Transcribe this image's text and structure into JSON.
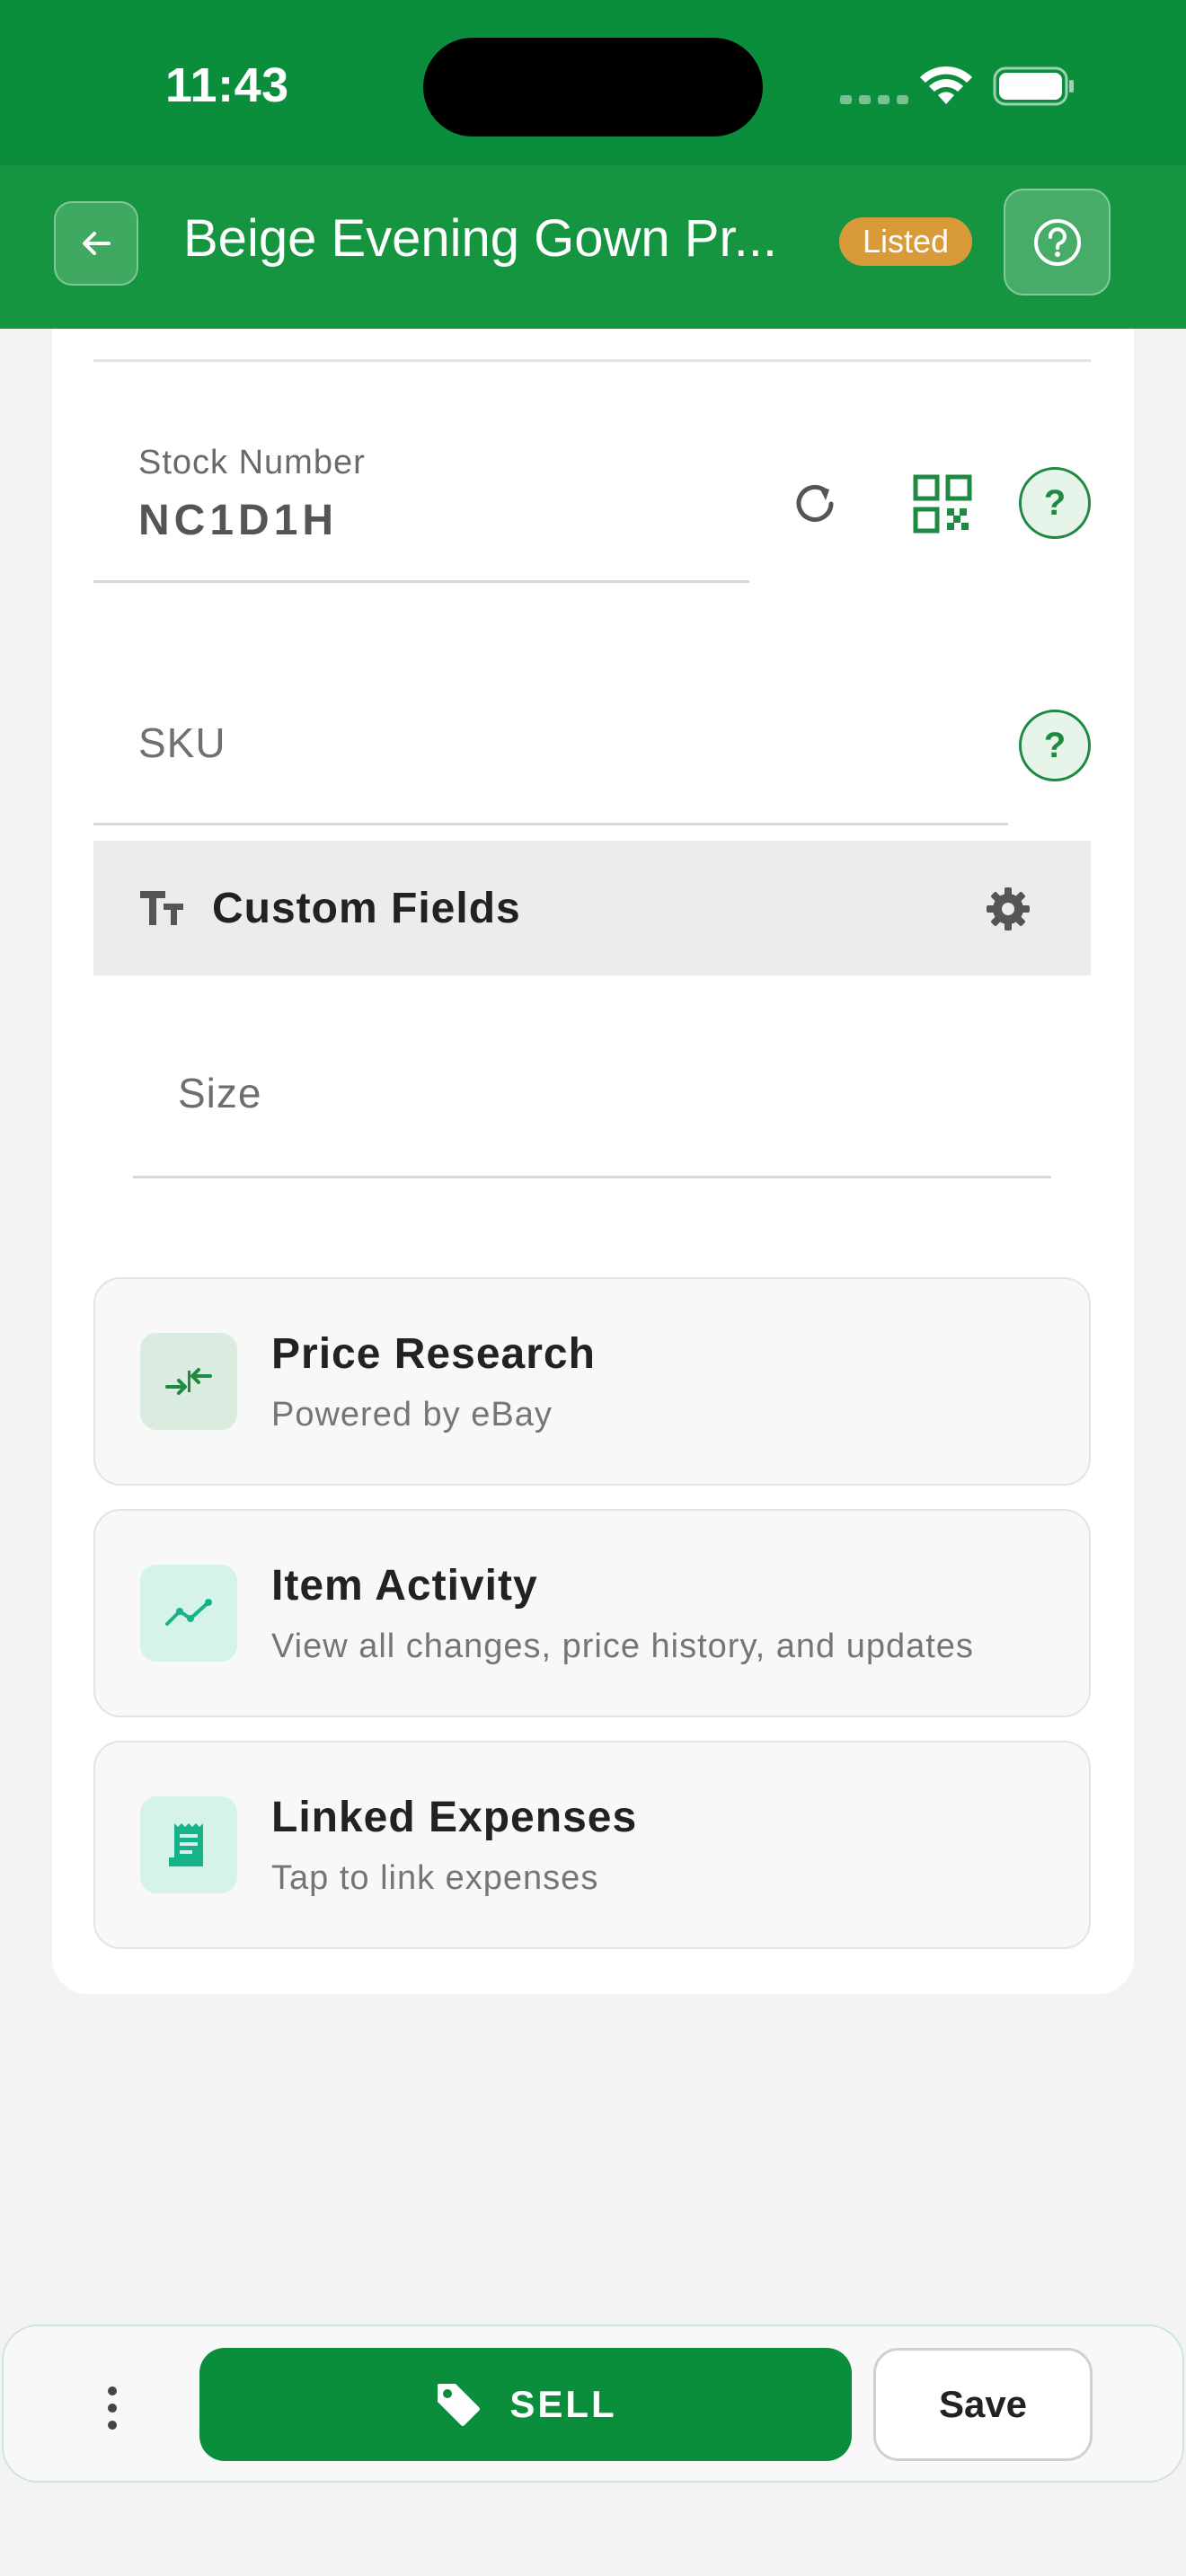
{
  "status_bar": {
    "time": "11:43"
  },
  "header": {
    "title": "Beige Evening Gown Pr...",
    "status_badge": "Listed",
    "colors": {
      "primary": "#0a8e3b",
      "badge": "#d99a3a"
    }
  },
  "fields": {
    "stock_number": {
      "label": "Stock Number",
      "value": "NC1D1H"
    },
    "sku": {
      "label": "SKU"
    }
  },
  "custom_fields": {
    "title": "Custom Fields",
    "items": [
      {
        "label": "Size"
      }
    ]
  },
  "actions": [
    {
      "title": "Price Research",
      "subtitle": "Powered by eBay",
      "icon": "compare-arrows-icon"
    },
    {
      "title": "Item Activity",
      "subtitle": "View all changes, price history, and updates",
      "icon": "trending-line-icon"
    },
    {
      "title": "Linked Expenses",
      "subtitle": "Tap to link expenses",
      "icon": "receipt-icon"
    }
  ],
  "bottom_bar": {
    "sell_label": "SELL",
    "save_label": "Save"
  }
}
